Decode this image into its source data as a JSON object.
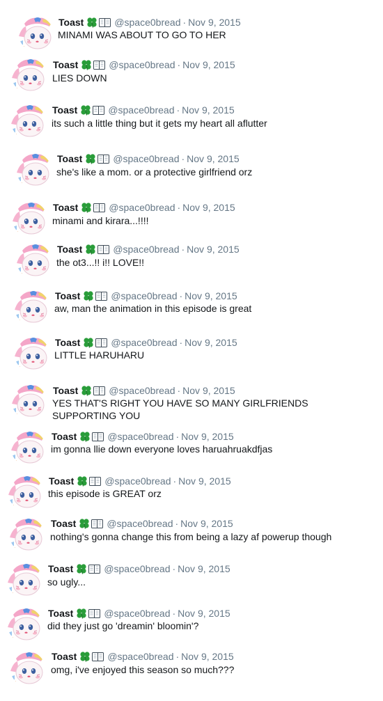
{
  "account": {
    "name": "Toast",
    "badges": [
      "four-leaf-clover-icon",
      "open-book-icon"
    ],
    "handle": "@space0bread"
  },
  "colors": {
    "text": "#14171a",
    "muted": "#657786",
    "clover": "#2a9d3a",
    "avatar_pink": "#f4a6c8",
    "avatar_blue": "#5a8fe0"
  },
  "tweets": [
    {
      "date": "Nov 9, 2015",
      "text": "MINAMI WAS ABOUT TO GO TO HER"
    },
    {
      "date": "Nov 9, 2015",
      "text": "LIES DOWN"
    },
    {
      "date": "Nov 9, 2015",
      "text": "its such a little thing but it gets my heart all aflutter"
    },
    {
      "date": "Nov 9, 2015",
      "text": "she's like a mom. or a protective girlfriend orz"
    },
    {
      "date": "Nov 9, 2015",
      "text": "minami and kirara...!!!!"
    },
    {
      "date": "Nov 9, 2015",
      "text": "the ot3...!! i!! LOVE!!"
    },
    {
      "date": "Nov 9, 2015",
      "text": "aw, man the animation in this episode is great"
    },
    {
      "date": "Nov 9, 2015",
      "text": "LITTLE HARUHARU"
    },
    {
      "date": "Nov 9, 2015",
      "text": "YES THAT'S RIGHT YOU HAVE SO MANY GIRLFRIENDS SUPPORTING YOU"
    },
    {
      "date": "Nov 9, 2015",
      "text": "im gonna llie down everyone loves haruahruakdfjas"
    },
    {
      "date": "Nov 9, 2015",
      "text": "this episode is GREAT orz"
    },
    {
      "date": "Nov 9, 2015",
      "text": "nothing's gonna change this from being a lazy af powerup though"
    },
    {
      "date": "Nov 9, 2015",
      "text": "so ugly..."
    },
    {
      "date": "Nov 9, 2015",
      "text": "did they just go 'dreamin' bloomin'?"
    },
    {
      "date": "Nov 9, 2015",
      "text": "omg, i've enjoyed this season so much???"
    }
  ]
}
